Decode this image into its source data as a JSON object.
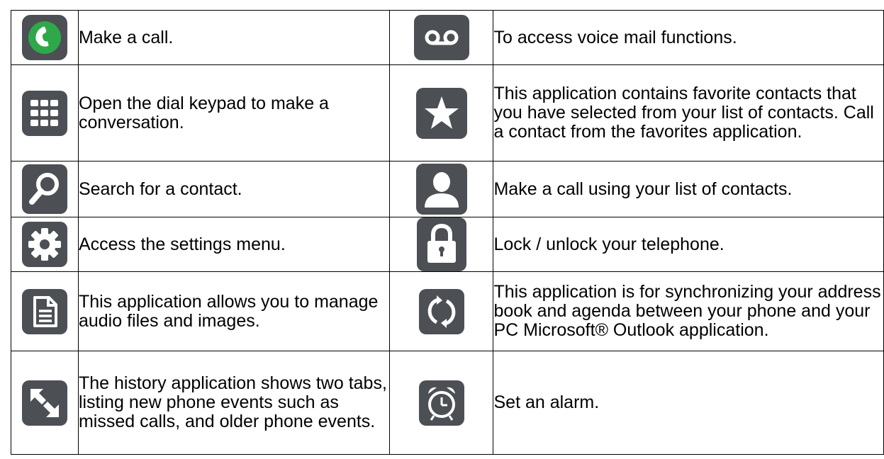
{
  "rows": [
    {
      "left": {
        "icon": "phone-icon",
        "text": "Make a call."
      },
      "right": {
        "icon": "voicemail-icon",
        "text": "To access voice mail functions."
      }
    },
    {
      "left": {
        "icon": "keypad-icon",
        "text": "Open the dial keypad to make a conversation."
      },
      "right": {
        "icon": "star-icon",
        "text": "This application contains favorite contacts that you have selected from your list of contacts. Call a contact from the favorites application."
      }
    },
    {
      "left": {
        "icon": "search-icon",
        "text": "Search for a contact."
      },
      "right": {
        "icon": "contact-icon",
        "text": "Make a call using your list of contacts."
      }
    },
    {
      "left": {
        "icon": "gear-icon",
        "text": "Access the settings menu."
      },
      "right": {
        "icon": "lock-icon",
        "text": "Lock / unlock your telephone."
      }
    },
    {
      "left": {
        "icon": "document-icon",
        "text": "This application allows you to manage audio files and images."
      },
      "right": {
        "icon": "sync-icon",
        "text": "This application is for synchronizing your address book and agenda between your phone and your PC Microsoft® Outlook application."
      }
    },
    {
      "left": {
        "icon": "history-arrows-icon",
        "text": "The history application shows two tabs, listing new phone events such as missed calls, and older phone events."
      },
      "right": {
        "icon": "alarm-clock-icon",
        "text": "Set an alarm."
      }
    }
  ],
  "colors": {
    "icon_background": "#4c4f54",
    "phone_icon_green": "#2ea84a",
    "glyph": "#ffffff",
    "border": "#000000"
  }
}
